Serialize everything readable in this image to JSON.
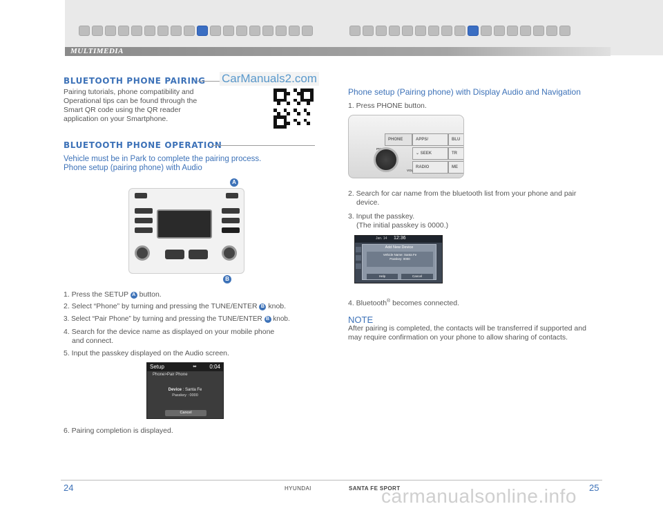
{
  "header": {
    "tab_label": "MULTIMEDIA"
  },
  "watermark": {
    "top": "CarManuals2.com",
    "bottom": "carmanualsonline.info"
  },
  "left": {
    "pairing": {
      "heading": "BLUETOOTH PHONE PAIRING",
      "lines": [
        "Pairing tutorials, phone compatibility and",
        "Operational tips can be found through the",
        "Smart QR code using the QR reader",
        "application on your Smartphone."
      ]
    },
    "operation": {
      "heading": "BLUETOOTH PHONE OPERATION",
      "subtitle_lines": [
        "Vehicle must be in Park to complete the pairing process.",
        "Phone setup (pairing phone) with Audio"
      ]
    },
    "callouts": {
      "a": "A",
      "b": "B"
    },
    "steps": {
      "s1_pre": "1. Press the SETUP ",
      "s1_post": " button.",
      "s2_pre": "2. Select “Phone” by turning and pressing the TUNE/ENTER ",
      "s2_post": " knob.",
      "s3_pre": "3. Select “Pair Phone” by turning and pressing the TUNE/ENTER ",
      "s3_post": " knob.",
      "s4_l1": "4. Search for the device name as displayed on your mobile phone",
      "s4_l2": "and connect.",
      "s5": "5. Input the passkey displayed on the Audio screen.",
      "s6": "6. Pairing completion is displayed."
    },
    "setup_screen": {
      "title": "Setup",
      "time": "0:04",
      "crumb": "Phone>Pair Phone",
      "device_label": "Device",
      "device_value": " : Santa Fe",
      "passkey": "Passkey : 0000",
      "cancel": "Cancel"
    }
  },
  "right": {
    "title": "Phone setup (Pairing phone) with Display Audio and Navigation",
    "s1": "1. Press PHONE button.",
    "nav_panel": {
      "phone": "PHONE",
      "apps": "APPS/",
      "blu": "BLU",
      "seek": "SEEK",
      "tr": "TR",
      "radio": "RADIO",
      "me": "ME",
      "pwr": "PWR",
      "push": "PUSH",
      "vol": "VOL"
    },
    "s2_l1": "2. Search for car name from the bluetooth list from your phone and pair",
    "s2_l2": "device.",
    "s3_l1": "3. Input the passkey.",
    "s3_l2": "(The initial passkey is 0000.)",
    "add_device": {
      "date": "Jan. 14",
      "time": "12:36",
      "title": "Add New Device",
      "vehicle_name": "Vehicle Name: Santa Fe",
      "passkey": "Passkey: 0000",
      "help": "Help",
      "cancel": "Cancel"
    },
    "s4_pre": "4. Bluetooth",
    "s4_sup": "®",
    "s4_post": " becomes connected.",
    "note_heading": "NOTE",
    "note_lines": [
      "After pairing is completed, the contacts will be transferred if supported and",
      "may require confirmation on your phone to allow sharing of contacts."
    ]
  },
  "footer": {
    "page_left": "24",
    "page_right": "25",
    "brand": "HYUNDAI",
    "model": "SANTA FE SPORT"
  },
  "colors": {
    "accent": "#3d72b8",
    "body_text": "#555555",
    "header_band": "#e9e9e9"
  }
}
